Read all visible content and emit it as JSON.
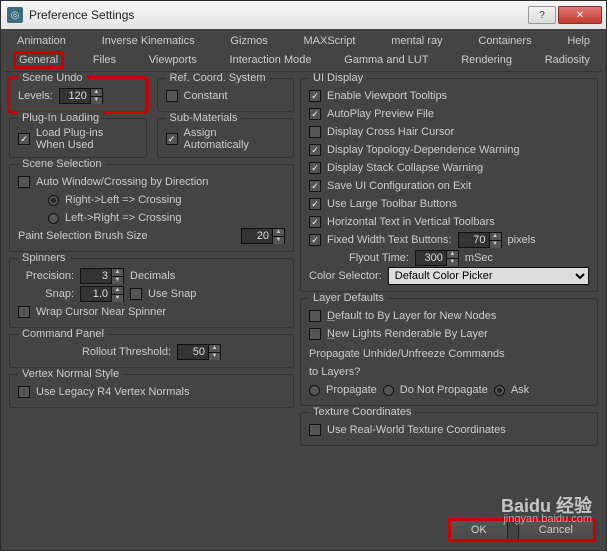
{
  "window": {
    "title": "Preference Settings"
  },
  "tabs_top": [
    "Animation",
    "Inverse Kinematics",
    "Gizmos",
    "MAXScript",
    "mental ray",
    "Containers",
    "Help"
  ],
  "tabs_bottom": [
    "General",
    "Files",
    "Viewports",
    "Interaction Mode",
    "Gamma and LUT",
    "Rendering",
    "Radiosity"
  ],
  "active_tab": "General",
  "left": {
    "sceneUndo": {
      "legend": "Scene Undo",
      "levelsLabel": "Levels:",
      "levels": "120"
    },
    "refCoord": {
      "legend": "Ref. Coord. System",
      "constant": "Constant"
    },
    "plugin": {
      "legend": "Plug-In Loading",
      "loadWhenUsed": "Load Plug-ins\nWhen Used"
    },
    "subMat": {
      "legend": "Sub-Materials",
      "assignAuto": "Assign\nAutomatically"
    },
    "sceneSel": {
      "legend": "Scene Selection",
      "autoWin": "Auto Window/Crossing by Direction",
      "opt1": "Right->Left => Crossing",
      "opt2": "Left->Right => Crossing",
      "brushLabel": "Paint Selection Brush Size",
      "brush": "20"
    },
    "spinners": {
      "legend": "Spinners",
      "precisionLabel": "Precision:",
      "precision": "3",
      "decimals": "Decimals",
      "snapLabel": "Snap:",
      "snap": "1.0",
      "useSnap": "Use Snap",
      "wrapCursor": "Wrap Cursor Near Spinner"
    },
    "cmdPanel": {
      "legend": "Command Panel",
      "rolloutLabel": "Rollout Threshold:",
      "rollout": "50"
    },
    "vertexNorm": {
      "legend": "Vertex Normal Style",
      "useLegacy": "Use Legacy R4 Vertex Normals"
    }
  },
  "right": {
    "uiDisplay": {
      "legend": "UI Display",
      "items": [
        {
          "label": "Enable Viewport Tooltips",
          "checked": true
        },
        {
          "label": "AutoPlay Preview File",
          "checked": true
        },
        {
          "label": "Display Cross Hair Cursor",
          "checked": false
        },
        {
          "label": "Display Topology-Dependence Warning",
          "checked": true
        },
        {
          "label": "Display Stack Collapse Warning",
          "checked": true
        },
        {
          "label": "Save UI Configuration on Exit",
          "checked": true
        },
        {
          "label": "Use Large Toolbar Buttons",
          "checked": true
        },
        {
          "label": "Horizontal Text in Vertical Toolbars",
          "checked": true
        }
      ],
      "fixedWidthLabel": "Fixed Width Text Buttons:",
      "fixedWidth": "70",
      "pixels": "pixels",
      "fixedWidthChecked": true,
      "flyoutLabel": "Flyout Time:",
      "flyout": "300",
      "msec": "mSec",
      "colorSelLabel": "Color Selector:",
      "colorSel": "Default Color Picker"
    },
    "layerDef": {
      "legend": "Layer Defaults",
      "defByLayer": "Default to By Layer for New Nodes",
      "newLights": "New Lights Renderable By Layer",
      "propLine1": "Propagate Unhide/Unfreeze Commands",
      "propLine2": "to Layers?",
      "optProp": "Propagate",
      "optDont": "Do Not Propagate",
      "optAsk": "Ask"
    },
    "texCoord": {
      "legend": "Texture Coordinates",
      "useReal": "Use Real-World Texture Coordinates"
    }
  },
  "footer": {
    "ok": "OK",
    "cancel": "Cancel"
  },
  "watermark": {
    "brand": "Baidu 经验",
    "url": "jingyan.baidu.com"
  }
}
